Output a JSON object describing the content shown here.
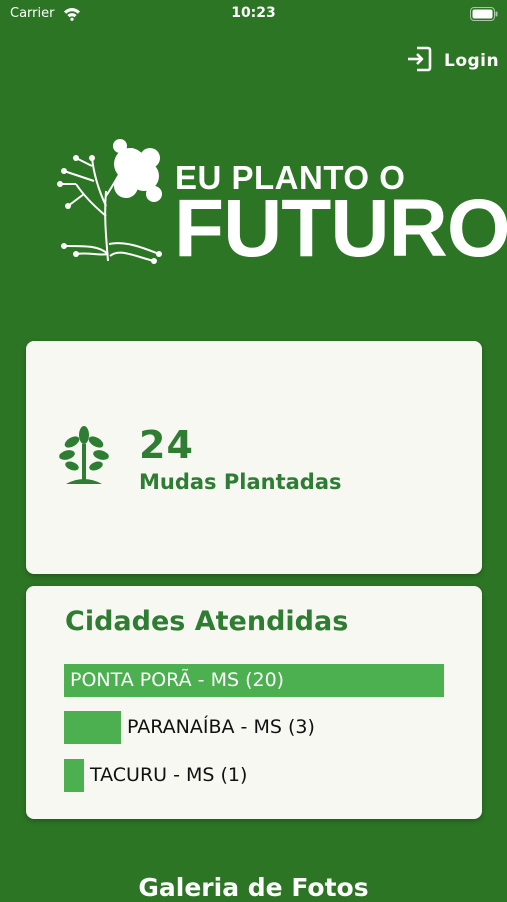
{
  "status_bar": {
    "carrier": "Carrier",
    "time": "10:23"
  },
  "header": {
    "login_label": "Login"
  },
  "logo": {
    "line1": "EU PLANTO O",
    "line2": "FUTURO"
  },
  "stats": {
    "count": "24",
    "label": "Mudas Plantadas"
  },
  "cities": {
    "title": "Cidades Atendidas",
    "max": 20,
    "items": [
      {
        "label": "PONTA PORÃ - MS (20)",
        "value": 20
      },
      {
        "label": "PARANAÍBA - MS (3)",
        "value": 3
      },
      {
        "label": "TACURU - MS (1)",
        "value": 1
      }
    ]
  },
  "gallery": {
    "title": "Galeria de Fotos"
  },
  "colors": {
    "background": "#2c7524",
    "accent": "#2e7d32",
    "bar": "#4caf50",
    "card": "#f8f8f3"
  }
}
